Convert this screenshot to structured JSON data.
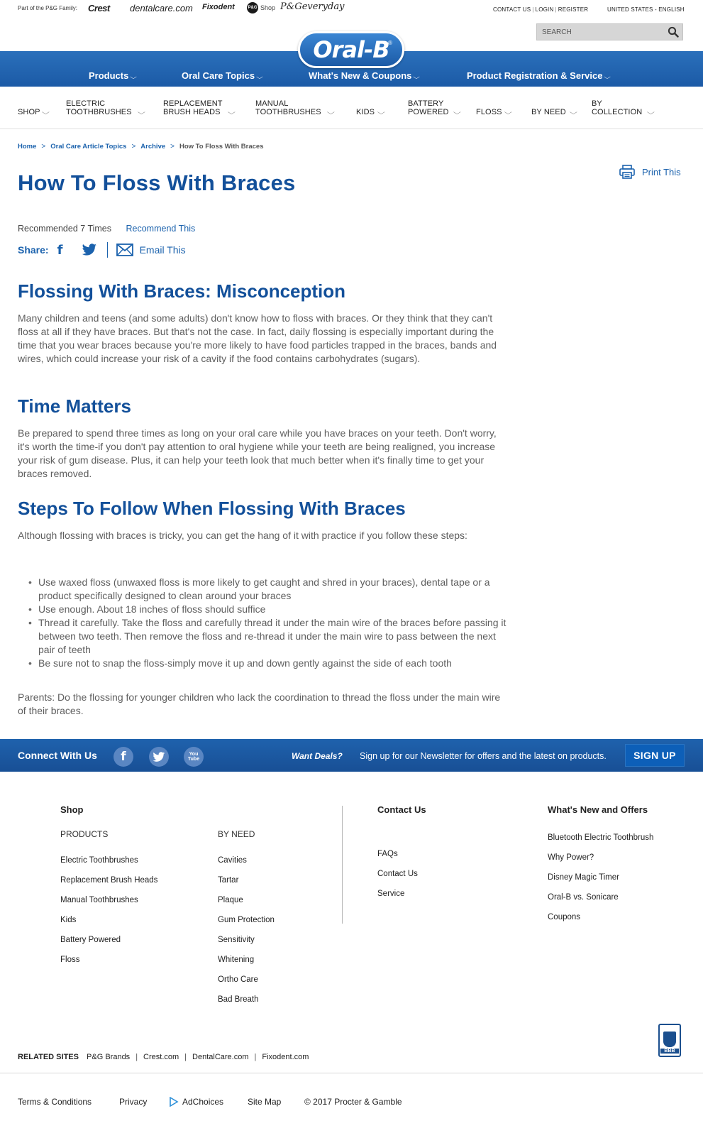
{
  "topbar": {
    "family_label": "Part of the P&G Family:",
    "brands": [
      "Crest",
      "dentalcare.com",
      "Fixodent",
      "Shop",
      "P&Geveryday"
    ],
    "pg_mark": "P&G",
    "util_links": [
      "CONTACT US",
      "LOGIN",
      "REGISTER"
    ],
    "locale": "UNITED STATES - ENGLISH",
    "search_placeholder": "SEARCH"
  },
  "logo": {
    "text": "Oral-B",
    "reg": "®"
  },
  "mainnav": [
    "Products",
    "Oral Care Topics",
    "What's New & Coupons",
    "Product Registration & Service"
  ],
  "catnav": [
    "Shop",
    "Electric Toothbrushes",
    "Replacement Brush Heads",
    "Manual Toothbrushes",
    "Kids",
    "Battery Powered",
    "Floss",
    "By Need",
    "By Collection"
  ],
  "breadcrumb": {
    "items": [
      "Home",
      "Oral Care Article Topics",
      "Archive"
    ],
    "sep": ">",
    "current": "How To Floss With Braces"
  },
  "print_label": "Print This",
  "article": {
    "title": "How To Floss With Braces",
    "recommended": "Recommended 7 Times",
    "recommend_link": "Recommend This",
    "share_label": "Share:",
    "facebook_glyph": "f",
    "email_label": "Email This",
    "sections": [
      {
        "heading": "Flossing With Braces: Misconception",
        "body": "Many children and teens (and some adults) don't know how to floss with braces. Or they think that they can't floss at all if they have braces. But that's not the case. In fact, daily flossing is especially important during the time that you wear braces because you're more likely to have food particles trapped in the braces, bands and wires, which could increase your risk of a cavity if the food contains carbohydrates (sugars)."
      },
      {
        "heading": "Time Matters",
        "body": "Be prepared to spend three times as long on your oral care while you have braces on your teeth. Don't worry, it's worth the time-if you don't pay attention to oral hygiene while your teeth are being realigned, you increase your risk of gum disease. Plus, it can help your teeth look that much better when it's finally time to get your braces removed."
      },
      {
        "heading": "Steps To Follow When Flossing With Braces",
        "body": "Although flossing with braces is tricky, you can get the hang of it with practice if you follow these steps:"
      }
    ],
    "steps": [
      "Use waxed floss (unwaxed floss is more likely to get caught and shred in your braces), dental tape or a product specifically designed to clean around your braces",
      "Use enough. About 18 inches of floss should suffice",
      "Thread it carefully. Take the floss and carefully thread it under the main wire of the braces before passing it between two teeth. Then remove the floss and re-thread it under the main wire to pass between the next pair of teeth",
      "Be sure not to snap the floss-simply move it up and down gently against the side of each tooth"
    ],
    "parents_note": "Parents: Do the flossing for younger children who lack the coordination to thread the floss under the main wire of their braces."
  },
  "connect": {
    "label": "Connect With Us",
    "facebook_glyph": "f",
    "youtube_label": [
      "You",
      "Tube"
    ],
    "want_deals": "Want Deals?",
    "newsletter": "Sign up for our Newsletter for offers and the latest on products.",
    "signup": "SIGN UP"
  },
  "footer": {
    "shop_heading": "Shop",
    "products_label": "PRODUCTS",
    "products": [
      "Electric Toothbrushes",
      "Replacement Brush Heads",
      "Manual Toothbrushes",
      "Kids",
      "Battery Powered",
      "Floss"
    ],
    "byneed_label": "BY NEED",
    "byneed": [
      "Cavities",
      "Tartar",
      "Plaque",
      "Gum Protection",
      "Sensitivity",
      "Whitening",
      "Ortho Care",
      "Bad Breath"
    ],
    "contact_heading": "Contact Us",
    "contact": [
      "FAQs",
      "Contact Us",
      "Service"
    ],
    "whatsnew_heading": "What's New and Offers",
    "whatsnew": [
      "Bluetooth Electric Toothbrush",
      "Why Power?",
      "Disney Magic Timer",
      "Oral-B vs. Sonicare",
      "Coupons"
    ],
    "bbb_label": "BBB",
    "related_label": "RELATED SITES",
    "related": [
      "P&G Brands",
      "Crest.com",
      "DentalCare.com",
      "Fixodent.com"
    ],
    "legal": [
      "Terms & Conditions",
      "Privacy",
      "AdChoices",
      "Site Map",
      "© 2017 Procter & Gamble"
    ]
  }
}
